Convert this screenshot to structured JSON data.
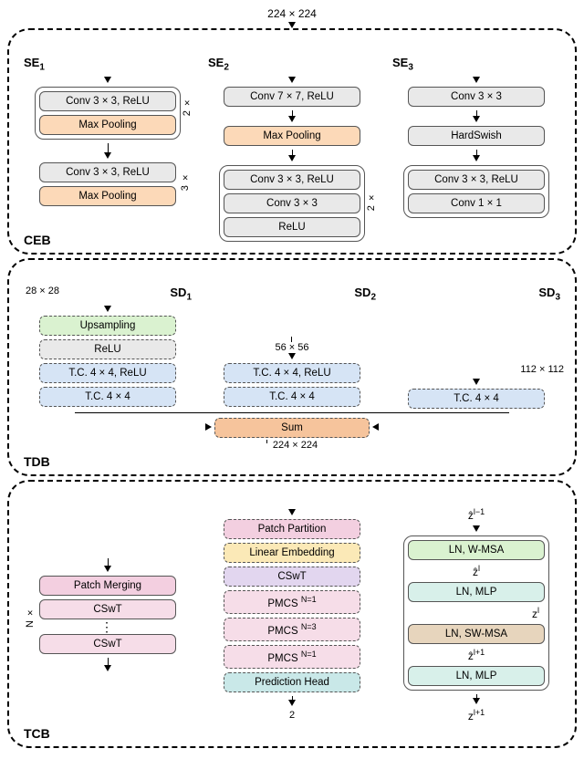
{
  "input_dim": "224 × 224",
  "ceb": {
    "label": "CEB",
    "se1": {
      "title": "SE",
      "sub": "1",
      "g1": {
        "mult": "2 ×",
        "conv": "Conv 3 × 3, ReLU",
        "pool": "Max Pooling"
      },
      "g2": {
        "mult": "3 ×",
        "conv": "Conv 3 × 3, ReLU",
        "pool": "Max Pooling"
      },
      "out_dim": "28 × 28"
    },
    "se2": {
      "title": "SE",
      "sub": "2",
      "conv": "Conv 7 × 7, ReLU",
      "pool": "Max Pooling",
      "g": {
        "mult": "2 ×",
        "conv1": "Conv 3 × 3, ReLU",
        "conv2": "Conv 3 × 3",
        "relu": "ReLU"
      }
    },
    "se3": {
      "title": "SE",
      "sub": "3",
      "conv1": "Conv 3 × 3",
      "act": "HardSwish",
      "g": {
        "conv1": "Conv 3 × 3, ReLU",
        "conv2": "Conv 1 × 1"
      }
    }
  },
  "tdb": {
    "label": "TDB",
    "sd1": {
      "title": "SD",
      "sub": "1",
      "upsamp": "Upsampling",
      "relu": "ReLU",
      "tc1": "T.C. 4 × 4, ReLU",
      "tc2": "T.C. 4 × 4"
    },
    "sd2": {
      "title": "SD",
      "sub": "2",
      "dim": "56 × 56",
      "tc1": "T.C. 4 × 4, ReLU",
      "tc2": "T.C. 4 × 4"
    },
    "sd3": {
      "title": "SD",
      "sub": "3",
      "dim": "112 × 112",
      "tc": "T.C. 4 × 4"
    },
    "sum": "Sum",
    "out_dim": "224 × 224"
  },
  "tcb": {
    "label": "TCB",
    "left": {
      "pm": "Patch Merging",
      "cswt": "CSwT",
      "mult": "N ×"
    },
    "mid": {
      "pp": "Patch Partition",
      "le": "Linear Embedding",
      "cswt": "CSwT",
      "pmcs1": "PMCS",
      "pmcs1_sup": "N=1",
      "pmcs2": "PMCS",
      "pmcs2_sup": "N=3",
      "pmcs3": "PMCS",
      "pmcs3_sup": "N=1",
      "pred": "Prediction Head",
      "out": "2"
    },
    "right": {
      "z_in": "ẑ",
      "z_in_sup": "l−1",
      "b1": "LN, W-MSA",
      "z1": "ẑ",
      "z1_sup": "l",
      "b2": "LN, MLP",
      "z2": "z",
      "z2_sup": "l",
      "b3": "LN, SW-MSA",
      "z3": "ẑ",
      "z3_sup": "l+1",
      "b4": "LN, MLP",
      "z_out": "z",
      "z_out_sup": "l+1"
    }
  },
  "chart_data": {
    "type": "diagram",
    "title": "Neural architecture with CEB, TDB, TCB blocks",
    "blocks": [
      {
        "name": "CEB",
        "branches": [
          "SE1",
          "SE2",
          "SE3"
        ]
      },
      {
        "name": "TDB",
        "branches": [
          "SD1",
          "SD2",
          "SD3"
        ],
        "merge": "Sum"
      },
      {
        "name": "TCB",
        "components": [
          "Patch Partition",
          "Linear Embedding",
          "CSwT",
          "PMCS N=1",
          "PMCS N=3",
          "PMCS N=1",
          "Prediction Head"
        ]
      }
    ],
    "dims": {
      "input": "224×224",
      "se1_out": "28×28",
      "sd2_in": "56×56",
      "sd3_in": "112×112",
      "tdb_out": "224×224",
      "output": 2
    },
    "pmcs_expansion": {
      "repeat": "N×",
      "items": [
        "Patch Merging",
        "CSwT",
        "...",
        "CSwT"
      ]
    },
    "cswt_expansion": [
      "LN, W-MSA",
      "LN, MLP",
      "LN, SW-MSA",
      "LN, MLP"
    ]
  }
}
